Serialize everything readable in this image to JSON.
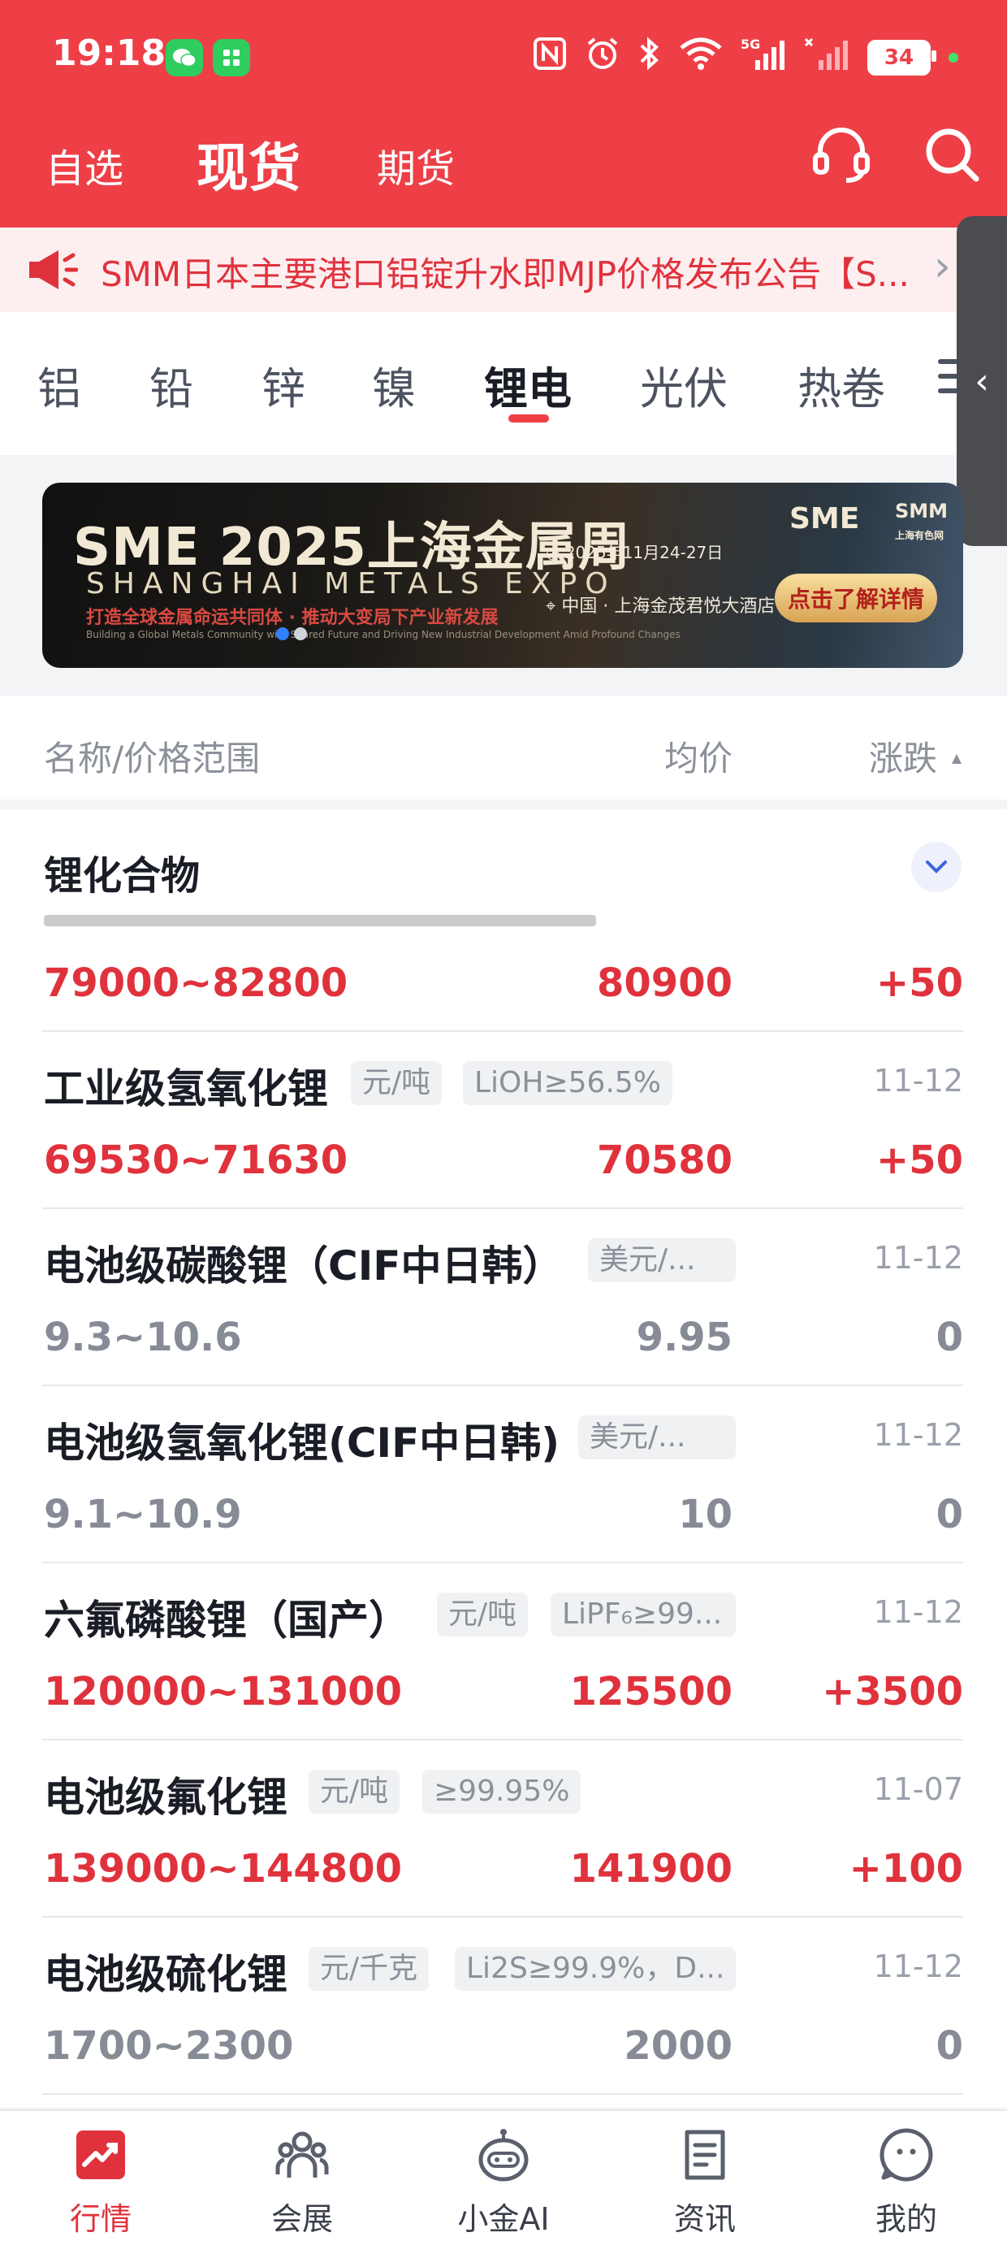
{
  "status_bar": {
    "time": "19:18",
    "battery": "34"
  },
  "nav": {
    "tabs": [
      "自选",
      "现货",
      "期货"
    ],
    "active": "现货"
  },
  "notice": {
    "text": "SMM日本主要港口铝锭升水即MJP价格发布公告【S..."
  },
  "categories": {
    "items": [
      "铝",
      "铅",
      "锌",
      "镍",
      "锂电",
      "光伏",
      "热卷"
    ],
    "active": "锂电"
  },
  "banner": {
    "title": "SME 2025上海金属周",
    "subtitle": "SHANGHAI METALS EXPO",
    "tagline": "打造全球金属命运共同体 · 推动大变局下产业新发展",
    "tagline_en": "Building a Global Metals Community with Shared Future and Driving New Industrial Development Amid Profound Changes",
    "date": "2025年11月24-27日",
    "place": "中国 · 上海金茂君悦大酒店",
    "logo": "SME",
    "logo2": "SMM",
    "logo2_sub": "上海有色网",
    "cta": "点击了解详情"
  },
  "list_header": {
    "name": "名称/价格范围",
    "avg": "均价",
    "change": "涨跌"
  },
  "section": {
    "title": "锂化合物"
  },
  "rows": [
    {
      "name": "工业级氢氧化锂",
      "tags": [
        "元/吨",
        "LiOH≥56.5%"
      ],
      "date": "11-12",
      "range": "69530~71630",
      "avg": "70580",
      "change": "+50",
      "up": true
    },
    {
      "name": "电池级碳酸锂（CIF中日韩）",
      "tags": [
        "美元/..."
      ],
      "date": "11-12",
      "range": "9.3~10.6",
      "avg": "9.95",
      "change": "0",
      "up": false
    },
    {
      "name": "电池级氢氧化锂(CIF中日韩)",
      "tags": [
        "美元/..."
      ],
      "date": "11-12",
      "range": "9.1~10.9",
      "avg": "10",
      "change": "0",
      "up": false
    },
    {
      "name": "六氟磷酸锂（国产）",
      "tags": [
        "元/吨",
        "LiPF₆≥99..."
      ],
      "date": "11-12",
      "range": "120000~131000",
      "avg": "125500",
      "change": "+3500",
      "up": true
    },
    {
      "name": "电池级氟化锂",
      "tags": [
        "元/吨",
        "≥99.95%"
      ],
      "date": "11-07",
      "range": "139000~144800",
      "avg": "141900",
      "change": "+100",
      "up": true
    },
    {
      "name": "电池级硫化锂",
      "tags": [
        "元/千克",
        "Li2S≥99.9%，D..."
      ],
      "date": "11-12",
      "range": "1700~2300",
      "avg": "2000",
      "change": "0",
      "up": false
    }
  ],
  "partial_row": {
    "range": "79000~82800",
    "avg": "80900",
    "change": "+50"
  },
  "tabbar": {
    "items": [
      "行情",
      "会展",
      "小金AI",
      "资讯",
      "我的"
    ],
    "active": "行情"
  },
  "colors": {
    "brand_red": "#ee3f47",
    "up_red": "#e0323c",
    "muted": "#868b96"
  }
}
